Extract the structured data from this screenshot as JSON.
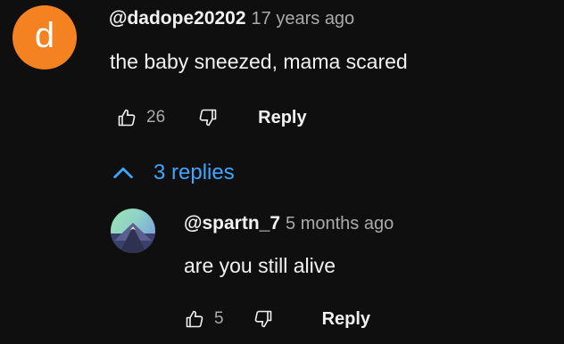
{
  "comment": {
    "avatar_letter": "d",
    "avatar_color": "#f58220",
    "author": "@dadope20202",
    "timestamp": "17 years ago",
    "text": "the baby sneezed, mama scared",
    "like_count": "26",
    "like_icon": "thumbs-up-icon",
    "dislike_icon": "thumbs-down-icon",
    "reply_label": "Reply"
  },
  "replies_toggle": {
    "icon": "chevron-up-icon",
    "label": "3 replies",
    "color": "#3ea6ff"
  },
  "reply": {
    "avatar_icon": "mountain-avatar-icon",
    "author": "@spartn_7",
    "timestamp": "5 months ago",
    "text": "are you still alive",
    "like_count": "5",
    "like_icon": "thumbs-up-icon",
    "dislike_icon": "thumbs-down-icon",
    "reply_label": "Reply"
  }
}
